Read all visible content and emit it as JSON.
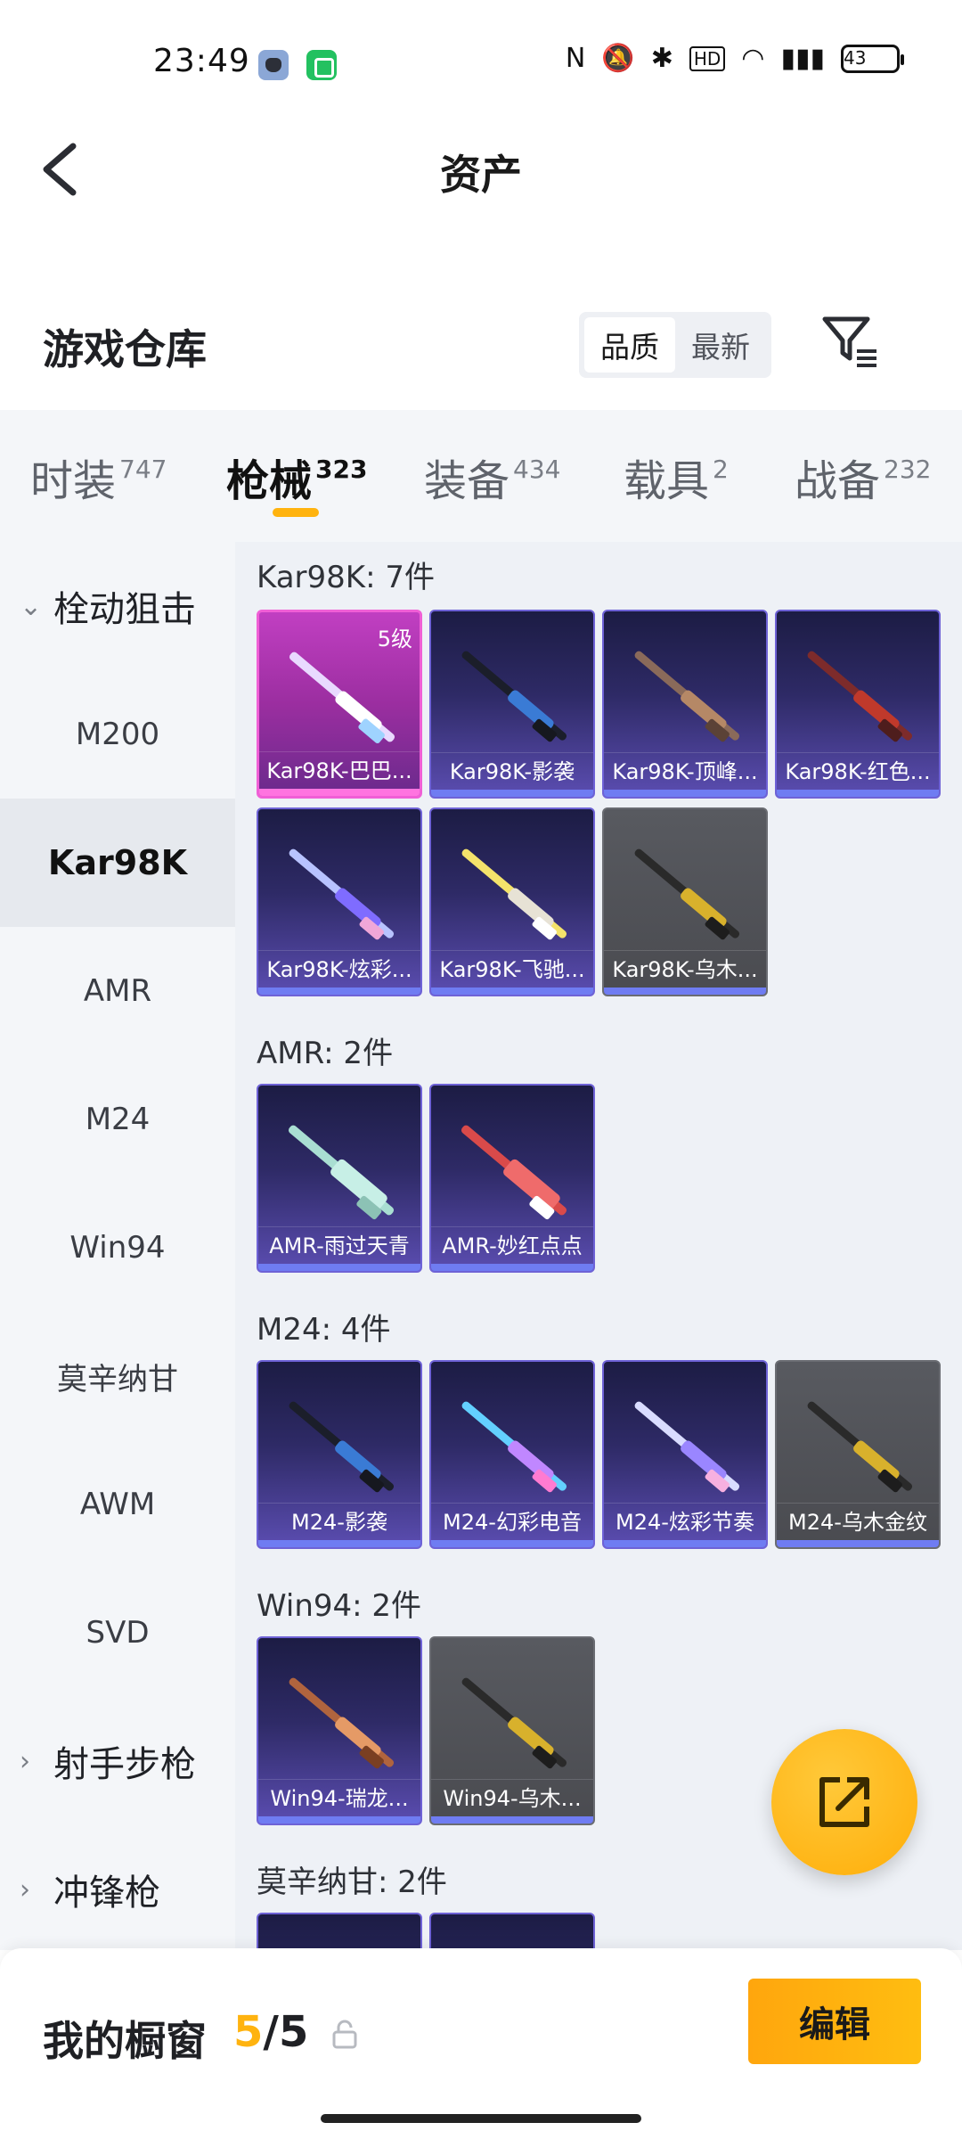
{
  "status_bar": {
    "time": "23:49",
    "battery": "43"
  },
  "header": {
    "title": "资产"
  },
  "warehouse": {
    "title": "游戏仓库",
    "sort_quality": "品质",
    "sort_latest": "最新"
  },
  "tabs": [
    {
      "label": "时装",
      "count": "747"
    },
    {
      "label": "枪械",
      "count": "323"
    },
    {
      "label": "装备",
      "count": "434"
    },
    {
      "label": "载具",
      "count": "2"
    },
    {
      "label": "战备",
      "count": "232"
    }
  ],
  "sidebar": {
    "group_bolt": "栓动狙击",
    "items": [
      "M200",
      "Kar98K",
      "AMR",
      "M24",
      "Win94",
      "莫辛纳甘",
      "AWM",
      "SVD"
    ],
    "group_marksman": "射手步枪",
    "group_smg": "冲锋枪"
  },
  "sections": {
    "kar98k": {
      "title": "Kar98K: 7件",
      "items": [
        "Kar98K-巴巴...",
        "Kar98K-影袭",
        "Kar98K-顶峰...",
        "Kar98K-红色...",
        "Kar98K-炫彩...",
        "Kar98K-飞驰...",
        "Kar98K-乌木..."
      ],
      "level": "5级"
    },
    "amr": {
      "title": "AMR: 2件",
      "items": [
        "AMR-雨过天青",
        "AMR-妙红点点"
      ]
    },
    "m24": {
      "title": "M24: 4件",
      "items": [
        "M24-影袭",
        "M24-幻彩电音",
        "M24-炫彩节奏",
        "M24-乌木金纹"
      ]
    },
    "win94": {
      "title": "Win94: 2件",
      "items": [
        "Win94-瑞龙...",
        "Win94-乌木..."
      ]
    },
    "mosin": {
      "title": "莫辛纳甘: 2件"
    }
  },
  "bottom": {
    "showcase_label": "我的橱窗",
    "current": "5",
    "sep": "/",
    "total": "5",
    "edit": "编辑"
  },
  "colors": {
    "accent": "#ffb30f",
    "card_purple": "#2e2a66",
    "card_gold": "#c13fc2",
    "card_gray": "#585a60"
  }
}
